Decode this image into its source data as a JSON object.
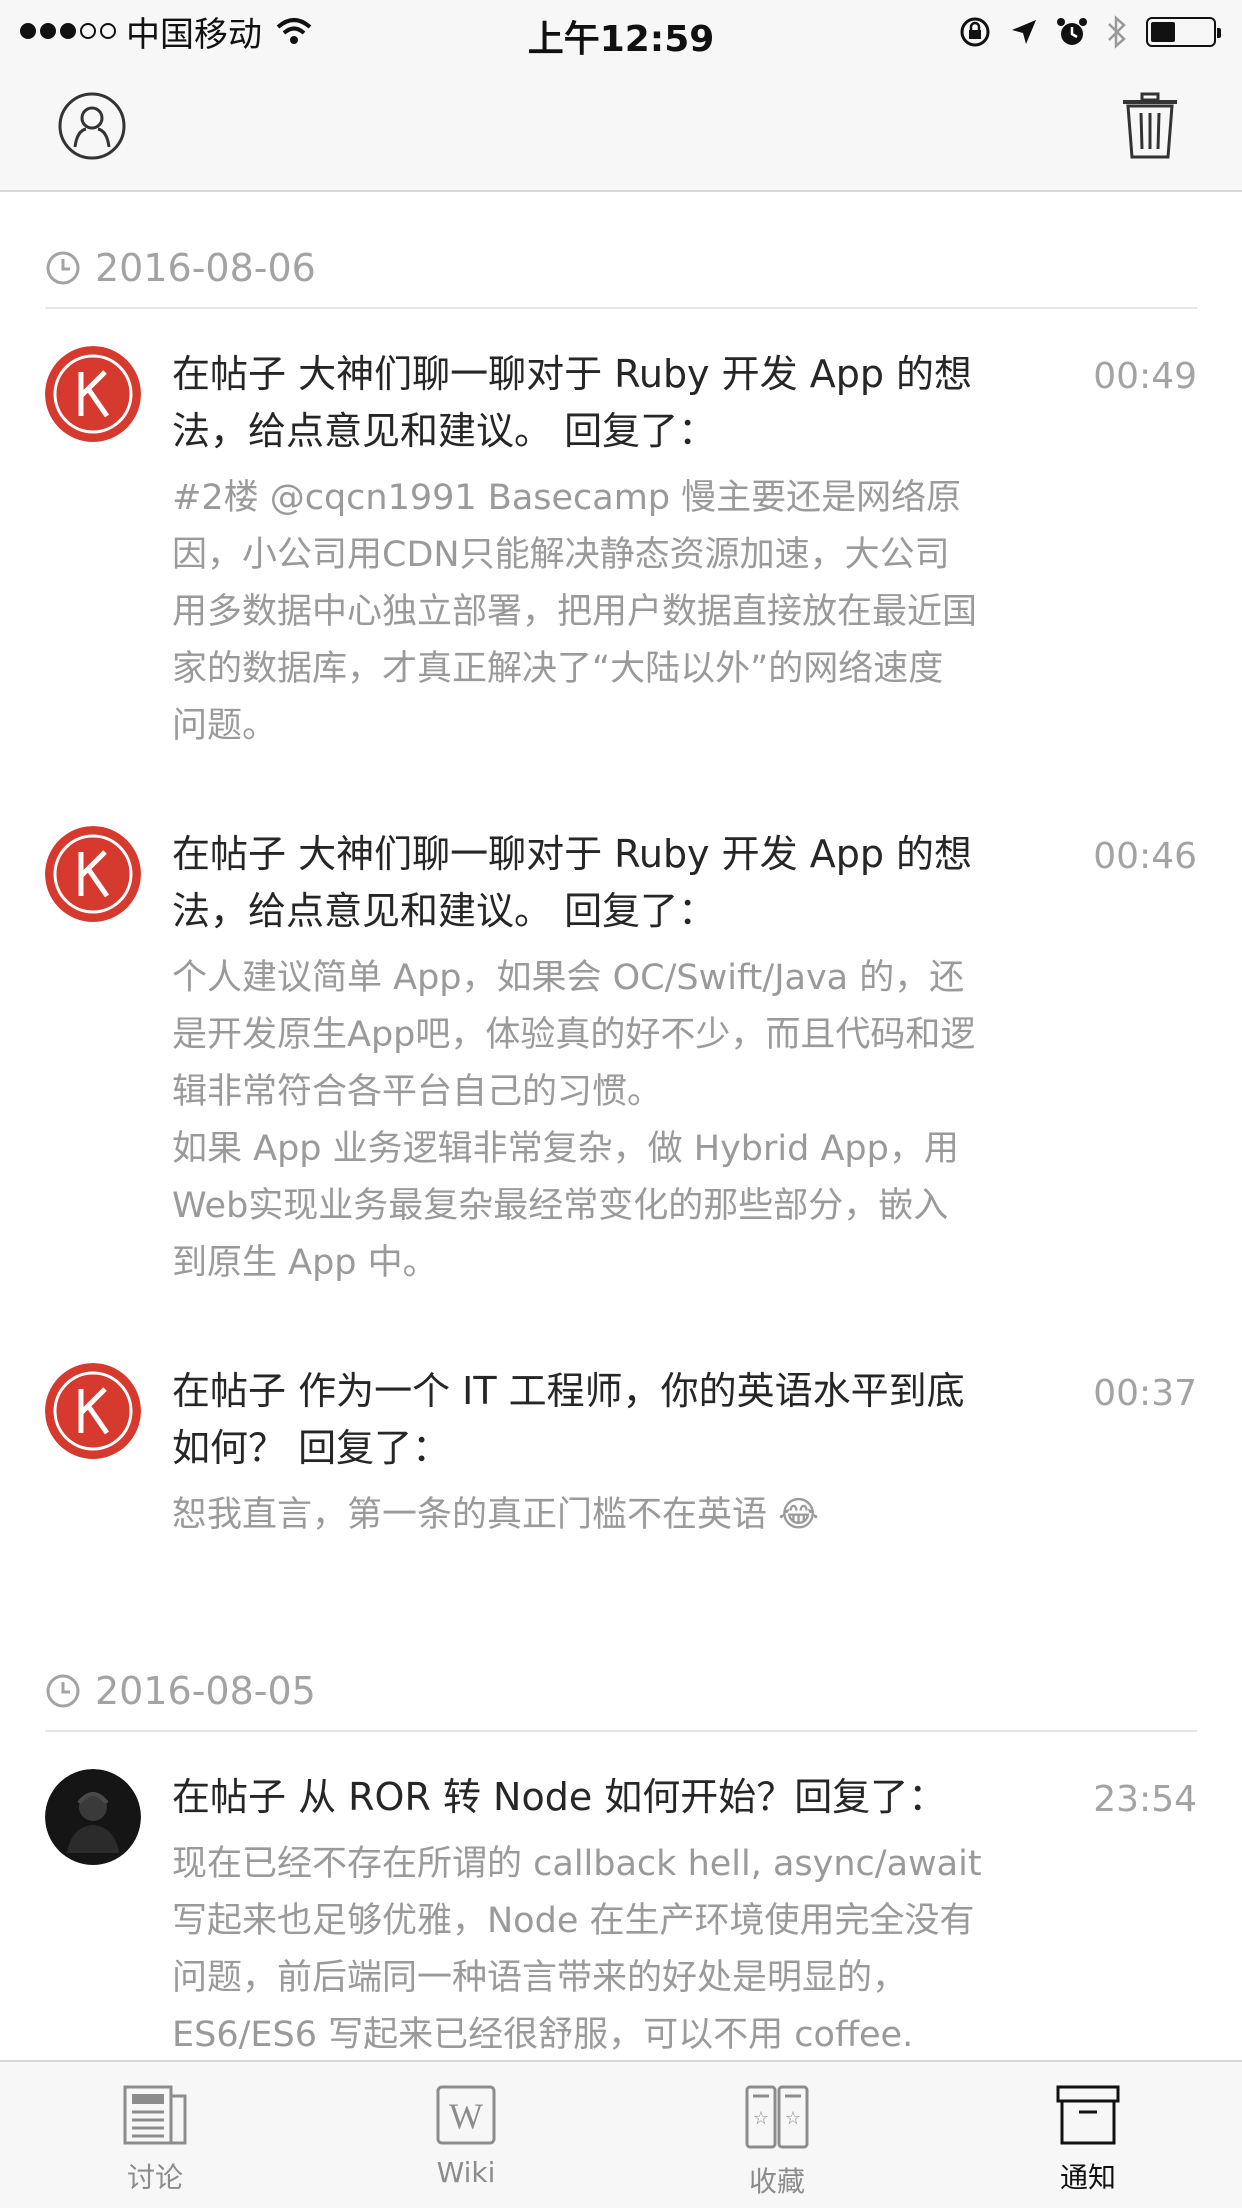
{
  "status_bar": {
    "carrier": "中国移动",
    "time": "上午12:59"
  },
  "nav": {
    "left_icon": "profile-icon",
    "right_icon": "trash-icon"
  },
  "sections": [
    {
      "date": "2016-08-06",
      "items": [
        {
          "title": "在帖子 大神们聊一聊对于 Ruby 开发 App 的想法，给点意见和建议。 回复了：",
          "title_lines": [
            "在帖子 大神们聊一聊对于 Ruby 开发 App 的想",
            "法，给点意见和建议。 回复了："
          ],
          "excerpt_lines": [
            "#2楼 @cqcn1991 Basecamp 慢主要还是网络原",
            "因，小公司用CDN只能解决静态资源加速，大公司",
            "用多数据中心独立部署，把用户数据直接放在最近国",
            "家的数据库，才真正解决了“大陆以外”的网络速度",
            "问题。"
          ],
          "time": "00:49"
        },
        {
          "title": "在帖子 大神们聊一聊对于 Ruby 开发 App 的想法，给点意见和建议。 回复了：",
          "title_lines": [
            "在帖子 大神们聊一聊对于 Ruby 开发 App 的想",
            "法，给点意见和建议。 回复了："
          ],
          "excerpt_lines": [
            "个人建议简单 App，如果会 OC/Swift/Java 的，还",
            "是开发原生App吧，体验真的好不少，而且代码和逻",
            "辑非常符合各平台自己的习惯。",
            "如果 App 业务逻辑非常复杂，做 Hybrid App，用",
            "Web实现业务最复杂最经常变化的那些部分，嵌入",
            "到原生 App 中。"
          ],
          "time": "00:46"
        },
        {
          "title": "在帖子 作为一个 IT 工程师，你的英语水平到底如何？ 回复了：",
          "title_lines": [
            "在帖子 作为一个 IT 工程师，你的英语水平到底",
            "如何？ 回复了："
          ],
          "excerpt_lines": [
            "恕我直言，第一条的真正门槛不在英语 😂"
          ],
          "time": "00:37"
        }
      ]
    },
    {
      "date": "2016-08-05",
      "items": [
        {
          "title": "在帖子 从 ROR 转 Node 如何开始？回复了：",
          "title_lines": [
            "在帖子 从 ROR 转 Node 如何开始？回复了："
          ],
          "excerpt_lines": [
            "现在已经不存在所谓的 callback hell, async/await",
            "写起来也足够优雅，Node 在生产环境使用完全没有",
            "问题，前后端同一种语言带来的好处是明显的，",
            "ES6/ES6 写起来已经很舒服，可以不用 coffee."
          ],
          "time": "23:54"
        }
      ]
    }
  ],
  "tabs": [
    {
      "label": "讨论",
      "icon": "discussion-icon",
      "active": false
    },
    {
      "label": "Wiki",
      "icon": "wiki-icon",
      "active": false
    },
    {
      "label": "收藏",
      "icon": "favorites-icon",
      "active": false
    },
    {
      "label": "通知",
      "icon": "notifications-icon",
      "active": true
    }
  ],
  "colors": {
    "avatar_red": "#d63a2e",
    "text_primary": "#262626",
    "text_secondary": "#9a9a9a",
    "text_muted": "#a3a3a3",
    "bar_background": "#f7f7f7"
  }
}
